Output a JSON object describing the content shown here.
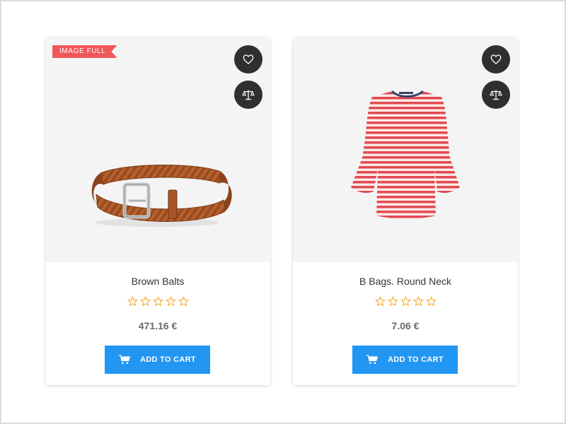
{
  "products": [
    {
      "badge": "IMAGE FULL",
      "name": "Brown Balts",
      "price": "471.16 €",
      "rating": 0,
      "max_rating": 5,
      "cart_label": "ADD TO CART",
      "wishlist_icon": "heart-icon",
      "compare_icon": "scale-icon"
    },
    {
      "name": "B Bags. Round Neck",
      "price": "7.06 €",
      "rating": 0,
      "max_rating": 5,
      "cart_label": "ADD TO CART",
      "wishlist_icon": "heart-icon",
      "compare_icon": "scale-icon"
    }
  ],
  "colors": {
    "accent": "#2196f3",
    "badge": "#f0575a",
    "star": "#f5a623",
    "icon_button": "#2f2f2f",
    "image_bg": "#f4f4f4"
  }
}
